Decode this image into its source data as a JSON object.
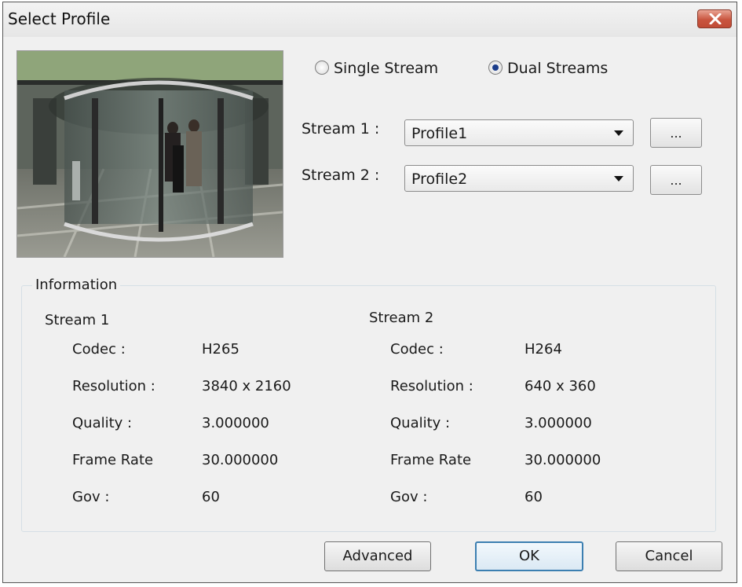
{
  "window": {
    "title": "Select Profile"
  },
  "stream_mode": {
    "single_label": "Single Stream",
    "dual_label": "Dual Streams",
    "selected": "Dual Streams"
  },
  "streams": [
    {
      "label": "Stream 1 :",
      "profile": "Profile1",
      "more_label": "..."
    },
    {
      "label": "Stream 2 :",
      "profile": "Profile2",
      "more_label": "..."
    }
  ],
  "information": {
    "legend": "Information",
    "stream1": {
      "title": "Stream 1",
      "rows": [
        {
          "key": "Codec :",
          "value": "H265"
        },
        {
          "key": "Resolution :",
          "value": "3840 x 2160"
        },
        {
          "key": "Quality :",
          "value": "3.000000"
        },
        {
          "key": "Frame Rate",
          "value": "30.000000"
        },
        {
          "key": "Gov :",
          "value": "60"
        }
      ]
    },
    "stream2": {
      "title": "Stream 2",
      "rows": [
        {
          "key": "Codec :",
          "value": "H264"
        },
        {
          "key": "Resolution :",
          "value": "640 x 360"
        },
        {
          "key": "Quality :",
          "value": "3.000000"
        },
        {
          "key": "Frame Rate",
          "value": "30.000000"
        },
        {
          "key": "Gov :",
          "value": "60"
        }
      ]
    }
  },
  "buttons": {
    "advanced": "Advanced",
    "ok": "OK",
    "cancel": "Cancel"
  },
  "icons": {
    "close": "close-icon",
    "preview": "camera-preview-image"
  }
}
